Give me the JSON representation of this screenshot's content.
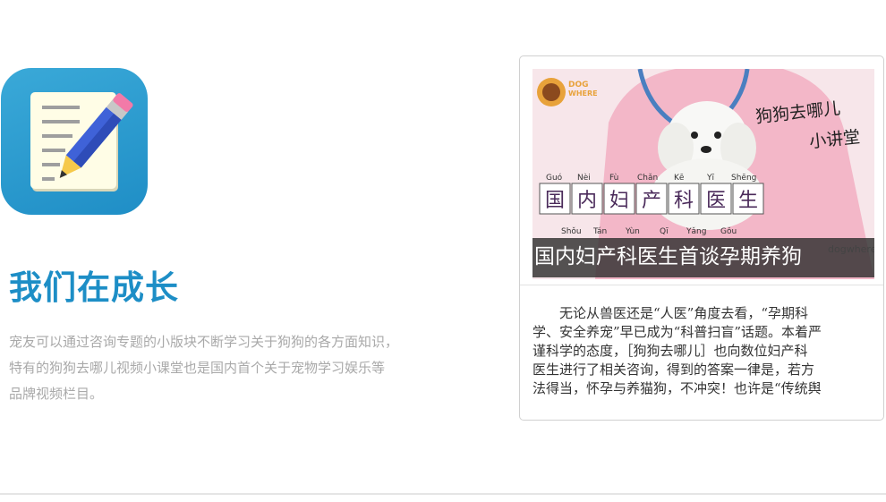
{
  "promo": {
    "heading": "我们在成长",
    "description_lines": [
      "宠友可以通过咨询专题的小版块不断学习关于狗狗的各方面知识，",
      "特有的狗狗去哪儿视频小课堂也是国内首个关于宠物学习娱乐等",
      "品牌视频栏目。"
    ]
  },
  "video_card": {
    "thumbnail": {
      "logo_text": [
        "DOG",
        "WHERE"
      ],
      "series_title": [
        "狗狗去哪儿",
        "小讲堂"
      ],
      "pinyin_row_1": [
        "Guó",
        "Nèi",
        "Fù",
        "Chǎn",
        "Kē",
        "Yī",
        "Shēng"
      ],
      "character_row_1": [
        "国",
        "内",
        "妇",
        "产",
        "科",
        "医",
        "生"
      ],
      "pinyin_row_2": [
        "Shǒu",
        "Tán",
        "Yùn",
        "Qī",
        "Yǎng",
        "Gǒu"
      ],
      "watermark": "dogwhere"
    },
    "caption": "国内妇产科医生首谈孕期养狗",
    "article_lines": [
      "　　无论从兽医还是“人医”角度去看，“孕期科",
      "学、安全养宠”早已成为“科普扫盲”话题。本着严",
      "谨科学的态度，［狗狗去哪儿］也向数位妇产科",
      "医生进行了相关咨询，得到的答案一律是，若方",
      "法得当，怀孕与养猫狗，不冲突！也许是“传统舆"
    ]
  },
  "colors": {
    "accent": "#1d8ec6",
    "muted_text": "#a9a9a9",
    "card_border": "#d0d0d0",
    "caption_bg": "#303030"
  }
}
